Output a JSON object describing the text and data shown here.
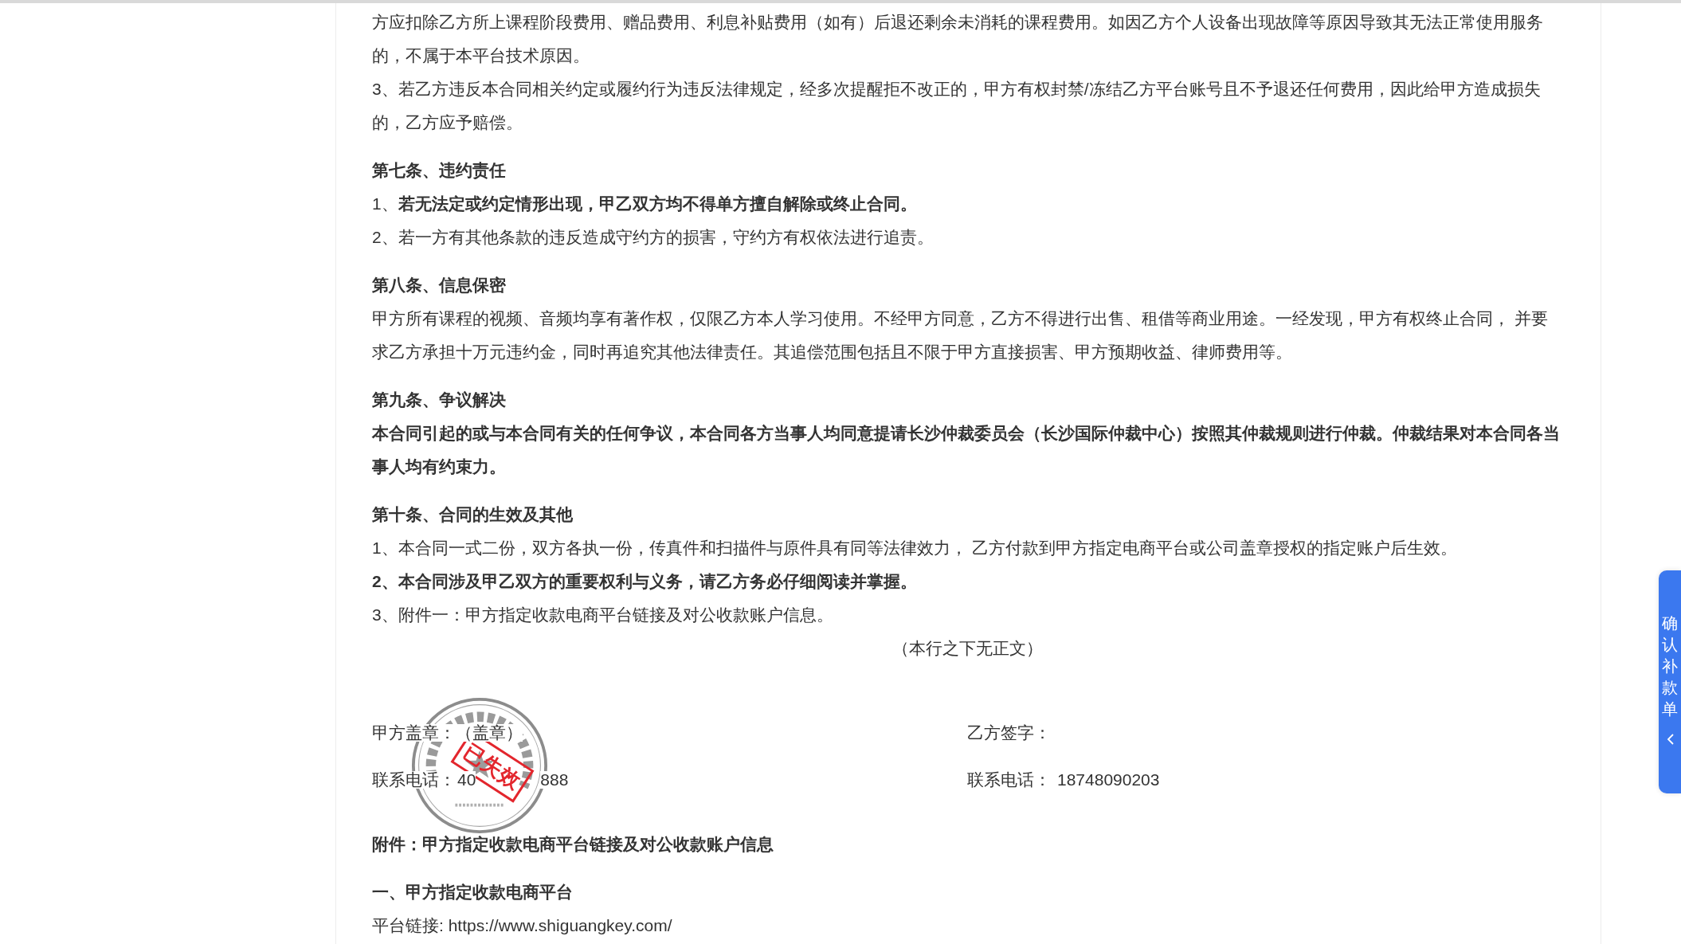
{
  "contract": {
    "blocks": [
      {
        "kind": "paragraph",
        "text": "方应扣除乙方所上课程阶段费用、赠品费用、利息补贴费用（如有）后退还剩余未消耗的课程费用。如因乙方个人设备出现故障等原因导致其无法正常使用服务的，不属于本平台技术原因。"
      },
      {
        "kind": "paragraph",
        "text": "3、若乙方违反本合同相关约定或履约行为违反法律规定，经多次提醒拒不改正的，甲方有权封禁/冻结乙方平台账号且不予退还任何费用，因此给甲方造成损失的，乙方应予赔偿。"
      },
      {
        "kind": "heading",
        "text": "第七条、违约责任"
      },
      {
        "kind": "paragraph",
        "text": "1、**若无法定或约定情形出现，甲乙双方均不得单方擅自解除或终止合同。**"
      },
      {
        "kind": "paragraph",
        "text": "2、若一方有其他条款的违反造成守约方的损害，守约方有权依法进行追责。"
      },
      {
        "kind": "heading",
        "text": "第八条、信息保密"
      },
      {
        "kind": "paragraph",
        "text": "甲方所有课程的视频、音频均享有著作权，仅限乙方本人学习使用。不经甲方同意，乙方不得进行出售、租借等商业用途。一经发现，甲方有权终止合同， 并要求乙方承担十万元违约金，同时再追究其他法律责任。其追偿范围包括且不限于甲方直接损害、甲方预期收益、律师费用等。"
      },
      {
        "kind": "heading",
        "text": "第九条、争议解决"
      },
      {
        "kind": "bold",
        "text": "本合同引起的或与本合同有关的任何争议，本合同各方当事人均同意提请长沙仲裁委员会（长沙国际仲裁中心）按照其仲裁规则进行仲裁。仲裁结果对本合同各当事人均有约束力。"
      },
      {
        "kind": "heading",
        "text": "第十条、合同的生效及其他"
      },
      {
        "kind": "paragraph",
        "text": "1、本合同一式二份，双方各执一份，传真件和扫描件与原件具有同等法律效力， 乙方付款到甲方指定电商平台或公司盖章授权的指定账户后生效。"
      },
      {
        "kind": "bold",
        "text": "2、本合同涉及甲乙双方的重要权利与义务，请乙方务必仔细阅读并掌握。"
      },
      {
        "kind": "paragraph",
        "text": "3、附件一：甲方指定收款电商平台链接及对公收款账户信息。"
      },
      {
        "kind": "note",
        "text": "（本行之下无正文）"
      }
    ],
    "signatures": {
      "party_a": {
        "sign_label": "甲方盖章：",
        "sign_value": "（盖章）",
        "phone_label": "联系电话：",
        "phone_fragments": [
          "40",
          "888"
        ]
      },
      "party_b": {
        "sign_label": "乙方签字：",
        "phone_label": "联系电话：",
        "phone_value": "18748090203"
      },
      "seal": {
        "stamp": "已失效"
      }
    },
    "appendix": [
      {
        "kind": "heading",
        "text": "附件：甲方指定收款电商平台链接及对公收款账户信息"
      },
      {
        "kind": "heading",
        "text": "一、甲方指定收款电商平台"
      },
      {
        "kind": "paragraph",
        "text": "平台链接: https://www.shiguangkey.com/"
      }
    ]
  },
  "side_tab": {
    "label": "确认补款单"
  }
}
